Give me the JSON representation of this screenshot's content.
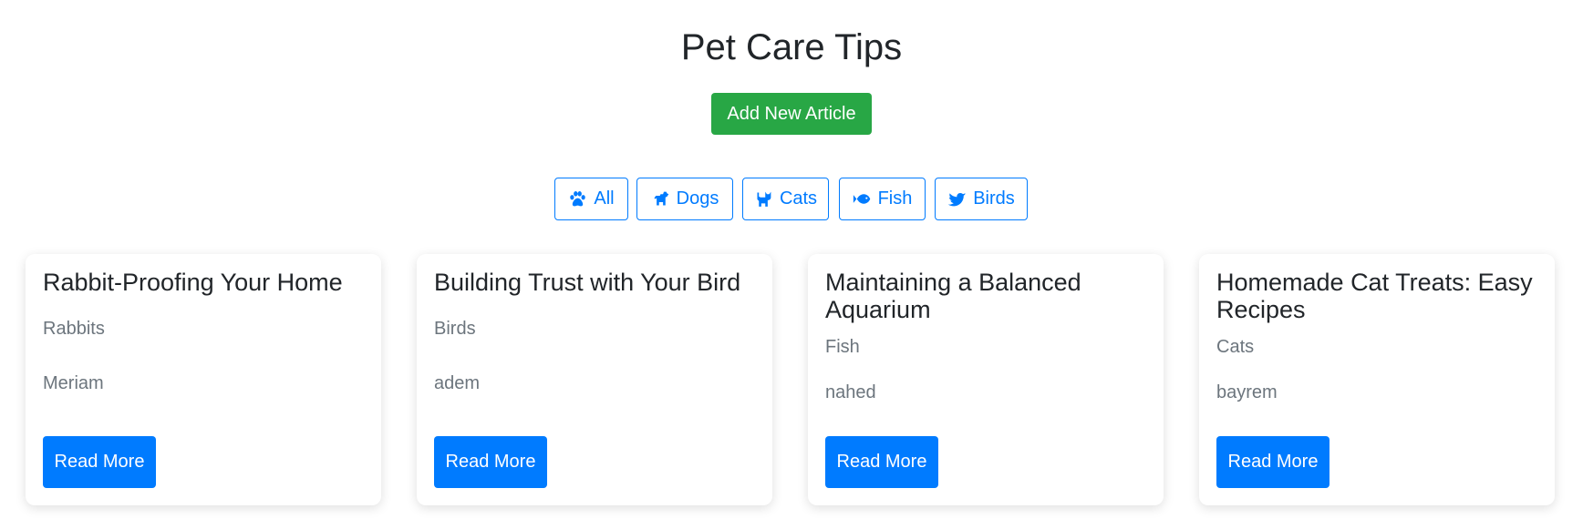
{
  "header": {
    "title": "Pet Care Tips",
    "add_button_label": "Add New Article"
  },
  "filters": [
    {
      "label": "All",
      "icon": "paw-icon"
    },
    {
      "label": "Dogs",
      "icon": "dog-icon"
    },
    {
      "label": "Cats",
      "icon": "cat-icon"
    },
    {
      "label": "Fish",
      "icon": "fish-icon"
    },
    {
      "label": "Birds",
      "icon": "bird-icon"
    }
  ],
  "articles": [
    {
      "title": "Rabbit-Proofing Your Home",
      "category": "Rabbits",
      "author": "Meriam",
      "button_label": "Read More"
    },
    {
      "title": "Building Trust with Your Bird",
      "category": "Birds",
      "author": "adem",
      "button_label": "Read More"
    },
    {
      "title": "Maintaining a Balanced Aquarium",
      "category": "Fish",
      "author": "nahed",
      "button_label": "Read More"
    },
    {
      "title": "Homemade Cat Treats: Easy Recipes",
      "category": "Cats",
      "author": "bayrem",
      "button_label": "Read More"
    }
  ],
  "colors": {
    "primary": "#007bff",
    "success": "#28a745",
    "muted": "#6c757d",
    "text": "#212529"
  }
}
